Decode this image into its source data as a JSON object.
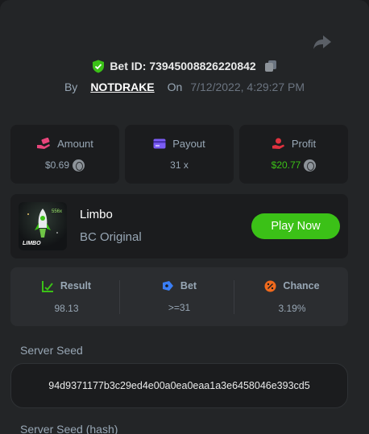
{
  "bet": {
    "id_label": "Bet ID: 73945008826220842",
    "by_label": "By",
    "user": "NOTDRAKE",
    "on_label": "On",
    "date": "7/12/2022, 4:29:27 PM"
  },
  "stats": {
    "amount": {
      "label": "Amount",
      "value": "$0.69"
    },
    "payout": {
      "label": "Payout",
      "value": "31 x"
    },
    "profit": {
      "label": "Profit",
      "value": "$20.77"
    }
  },
  "game": {
    "name": "Limbo",
    "subtitle": "BC Original",
    "play_label": "Play Now",
    "thumb_brand": "LIMBO",
    "thumb_badge": "556x"
  },
  "result": {
    "result": {
      "label": "Result",
      "value": "98.13"
    },
    "bet": {
      "label": "Bet",
      "value": ">=31"
    },
    "chance": {
      "label": "Chance",
      "value": "3.19%"
    }
  },
  "seeds": {
    "server_seed_label": "Server Seed",
    "server_seed": "94d9371177b3c29ed4e00a0ea0eaa1a3e6458046e393cd5",
    "server_seed_hash_label": "Server Seed (hash)"
  },
  "colors": {
    "accent_green": "#3bc117",
    "muted_text": "#98a7b5",
    "amount_icon": "#e8457b",
    "payout_icon": "#7b5cf5",
    "profit_icon": "#e0323f",
    "bet_icon": "#3a7ef5",
    "chance_icon": "#f06a1d"
  },
  "icons": {
    "share": "share-arrow-icon",
    "verified": "shield-check-icon",
    "copy": "copy-icon",
    "amount": "money-hand-icon",
    "payout": "card-icon",
    "profit": "profit-hand-icon",
    "result": "chart-check-icon",
    "bet": "ticket-icon",
    "chance": "percent-icon",
    "coin": "coin-icon"
  }
}
